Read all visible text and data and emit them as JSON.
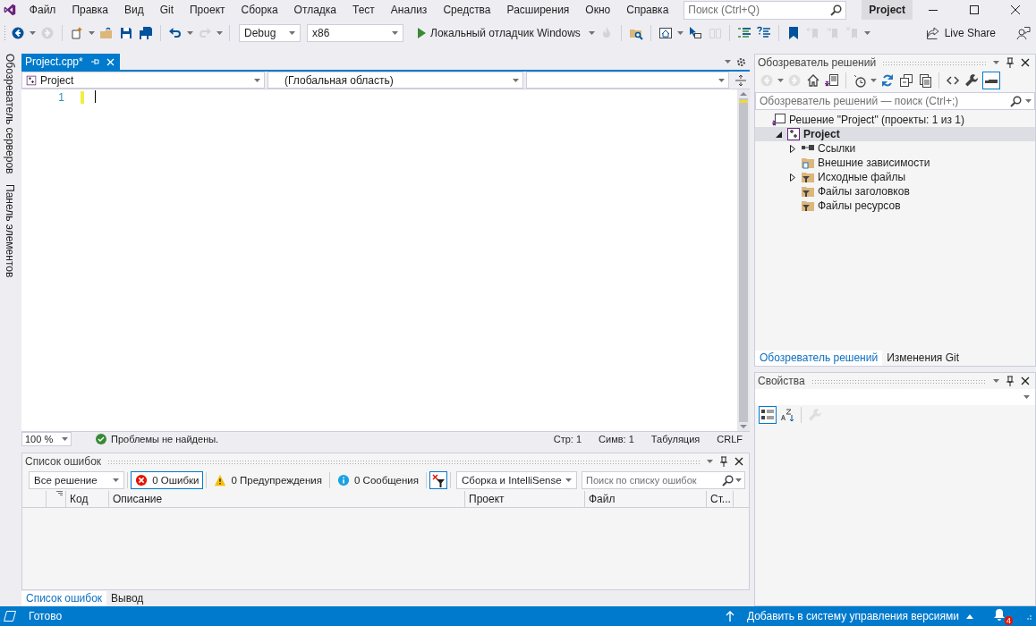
{
  "menu": [
    "Файл",
    "Правка",
    "Вид",
    "Git",
    "Проект",
    "Сборка",
    "Отладка",
    "Тест",
    "Анализ",
    "Средства",
    "Расширения",
    "Окно",
    "Справка"
  ],
  "search": {
    "placeholder": "Поиск (Ctrl+Q)"
  },
  "solution_badge": "Project",
  "toolbar": {
    "buttons": [
      {
        "kind": "back",
        "disabled": false
      },
      {
        "kind": "forward",
        "disabled": true
      },
      {
        "kind": "new-project",
        "disabled": false
      },
      {
        "kind": "open",
        "disabled": false
      },
      {
        "kind": "save",
        "disabled": false
      },
      {
        "kind": "save-all",
        "disabled": false
      },
      {
        "kind": "undo",
        "disabled": false
      },
      {
        "kind": "redo",
        "disabled": true
      }
    ],
    "configuration": "Debug",
    "platform": "x86",
    "run_label": "Локальный отладчик Windows",
    "buttons_2": [
      {
        "kind": "flame",
        "disabled": true
      },
      {
        "kind": "folder-search",
        "disabled": false
      },
      {
        "kind": "browser",
        "disabled": false
      },
      {
        "kind": "pointer",
        "disabled": false
      },
      {
        "kind": "columns",
        "disabled": true
      },
      {
        "kind": "comment",
        "disabled": false
      },
      {
        "kind": "uncomment",
        "disabled": false
      },
      {
        "kind": "bookmark",
        "disabled": false
      },
      {
        "kind": "bookmark-prev",
        "disabled": true
      },
      {
        "kind": "bookmark-next",
        "disabled": true
      },
      {
        "kind": "bookmark-clear",
        "disabled": true
      }
    ],
    "live_share": "Live Share"
  },
  "side_strip": [
    "Обозреватель серверов",
    "Панель элементов"
  ],
  "editor": {
    "tabs": [
      {
        "label": "Project.cpp*",
        "selected": true
      }
    ],
    "nav": [
      "Project",
      "(Глобальная область)"
    ],
    "line_numbers": [
      "1"
    ],
    "zoom": "100 %",
    "issues": "Проблемы не найдены.",
    "position": [
      "Стр: 1",
      "Симв: 1",
      "Табуляция",
      "CRLF"
    ]
  },
  "error_list": {
    "title": "Список ошибок",
    "scope": "Все решение",
    "filters": [
      {
        "kind": "error",
        "label": "0 Ошибки",
        "selected": true
      },
      {
        "kind": "warning",
        "label": "0 Предупреждения",
        "selected": false
      },
      {
        "kind": "info",
        "label": "0 Сообщения",
        "selected": false
      }
    ],
    "clear_filter": {
      "on": true
    },
    "source": "Сборка и IntelliSense",
    "search_placeholder": "Поиск по списку ошибок",
    "columns": [
      "Код",
      "Описание",
      "Проект",
      "Файл",
      "Ст..."
    ]
  },
  "bottom_tabs": [
    {
      "label": "Список ошибок",
      "selected": true
    },
    {
      "label": "Вывод",
      "selected": false
    }
  ],
  "solution_explorer": {
    "title": "Обозреватель решений",
    "buttons": [
      {
        "kind": "back",
        "disabled": true,
        "on": false
      },
      {
        "kind": "forward",
        "disabled": true,
        "on": false
      },
      {
        "kind": "home",
        "disabled": false,
        "on": false
      },
      {
        "kind": "vs-switch",
        "disabled": false,
        "on": false
      },
      {
        "kind": "history",
        "disabled": false,
        "on": false
      },
      {
        "kind": "sync",
        "disabled": false,
        "on": false
      },
      {
        "kind": "collapse",
        "disabled": false,
        "on": false
      },
      {
        "kind": "copy-all",
        "disabled": false,
        "on": false
      },
      {
        "kind": "code",
        "disabled": false,
        "on": false
      },
      {
        "kind": "wrench",
        "disabled": false,
        "on": false
      },
      {
        "kind": "preview",
        "disabled": false,
        "on": true
      }
    ],
    "search_placeholder": "Обозреватель решений — поиск (Ctrl+;)",
    "tree": [
      {
        "kind": "solution",
        "label": "Решение \"Project\" (проекты: 1 из 1)",
        "selected": false,
        "children": [
          {
            "kind": "project",
            "label": "Project",
            "selected": true,
            "startup": true,
            "expanded": true,
            "children": [
              {
                "kind": "references",
                "label": "Ссылки",
                "selected": false,
                "expanded": false
              },
              {
                "kind": "external",
                "label": "Внешние зависимости",
                "selected": false
              },
              {
                "kind": "filter",
                "label": "Исходные файлы",
                "selected": false,
                "expanded": false
              },
              {
                "kind": "filter",
                "label": "Файлы заголовков",
                "selected": false
              },
              {
                "kind": "filter",
                "label": "Файлы ресурсов",
                "selected": false
              }
            ]
          }
        ]
      }
    ],
    "tabs": [
      {
        "label": "Обозреватель решений",
        "selected": true
      },
      {
        "label": "Изменения Git",
        "selected": false
      }
    ]
  },
  "properties": {
    "title": "Свойства",
    "buttons": [
      {
        "kind": "categorized",
        "disabled": false,
        "on": true
      },
      {
        "kind": "alphabetical",
        "disabled": false,
        "on": false
      },
      {
        "kind": "wrench",
        "disabled": true,
        "on": false
      }
    ]
  },
  "status_bar": {
    "text": "Готово",
    "source_control": "Добавить в систему управления версиями",
    "notifications": "4"
  }
}
